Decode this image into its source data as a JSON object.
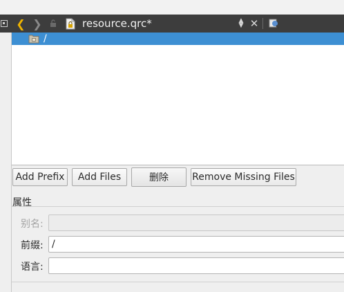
{
  "editor": {
    "filename": "resource.qrc*"
  },
  "tree": {
    "selected_item": "/"
  },
  "buttons": {
    "add_prefix": "Add Prefix",
    "add_files": "Add Files",
    "delete": "删除",
    "remove_missing": "Remove Missing Files"
  },
  "properties": {
    "title": "属性",
    "alias_label": "别名:",
    "alias_value": "",
    "prefix_label": "前缀:",
    "prefix_value": "/",
    "language_label": "语言:",
    "language_value": ""
  },
  "colors": {
    "toolbar_bg": "#3d3d3d",
    "back_arrow": "#f0b400",
    "selection": "#3d8fd3"
  }
}
